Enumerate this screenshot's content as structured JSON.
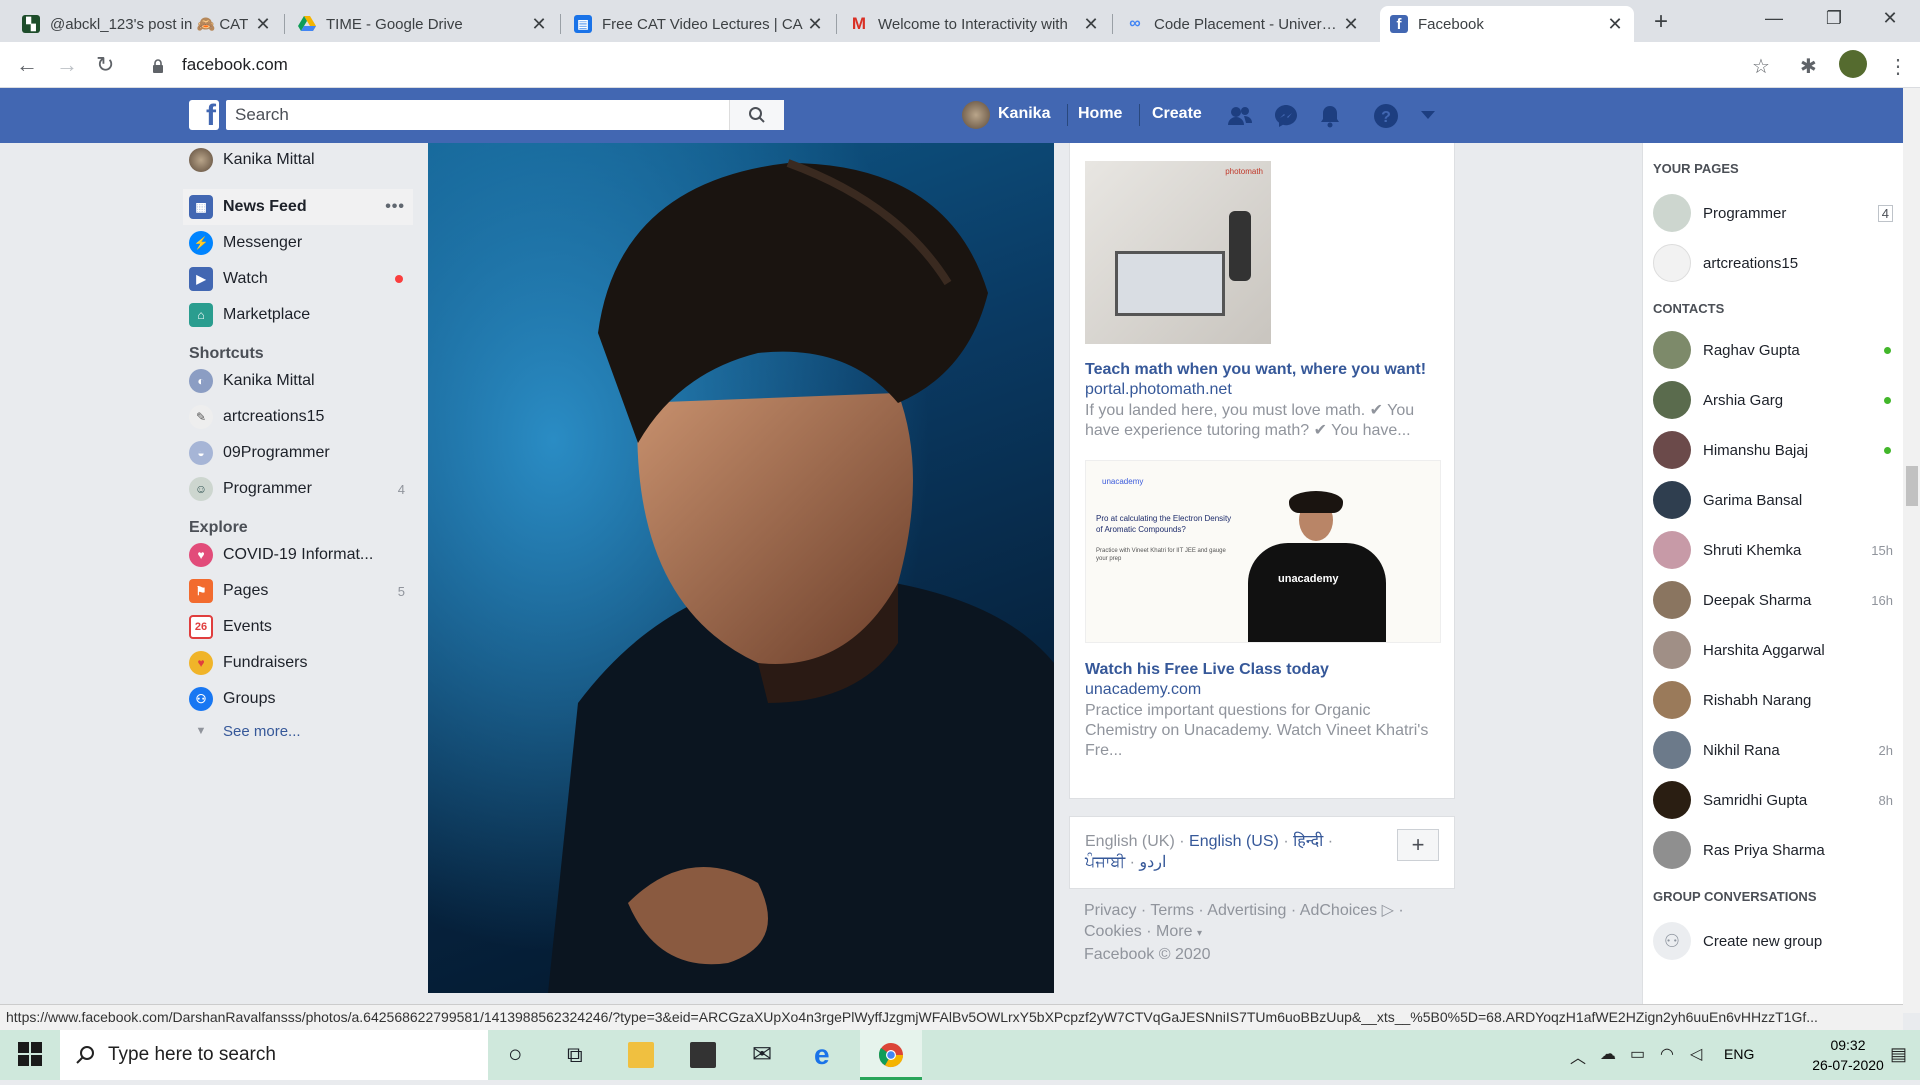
{
  "browser": {
    "tabs": [
      {
        "title": "@abckl_123's post in 🙈 CAT",
        "icon": "instagram-style-icon",
        "color": "#1e4d2b"
      },
      {
        "title": "TIME - Google Drive",
        "icon": "google-drive-icon",
        "color": "#f4b400"
      },
      {
        "title": "Free CAT Video Lectures | CA",
        "icon": "lectures-icon",
        "color": "#1a73e8"
      },
      {
        "title": "Welcome to Interactivity with",
        "icon": "gmail-icon",
        "color": "#d93025"
      },
      {
        "title": "Code Placement - University",
        "icon": "link-icon",
        "color": "#4285f4"
      },
      {
        "title": "Facebook",
        "icon": "facebook-icon",
        "color": "#4267b2"
      }
    ],
    "url": "facebook.com"
  },
  "fb": {
    "search_placeholder": "Search",
    "profile_name": "Kanika",
    "home": "Home",
    "create": "Create"
  },
  "left": {
    "user": "Kanika Mittal",
    "nav": [
      {
        "label": "News Feed",
        "icon": "news-feed-icon",
        "color": "#4267b2"
      },
      {
        "label": "Messenger",
        "icon": "messenger-icon",
        "color": "#0084ff"
      },
      {
        "label": "Watch",
        "icon": "watch-icon",
        "color": "#4267b2"
      },
      {
        "label": "Marketplace",
        "icon": "marketplace-icon",
        "color": "#2a9d8f"
      }
    ],
    "shortcuts_title": "Shortcuts",
    "shortcuts": [
      {
        "label": "Kanika Mittal",
        "count": ""
      },
      {
        "label": "artcreations15",
        "count": ""
      },
      {
        "label": "09Programmer",
        "count": ""
      },
      {
        "label": "Programmer",
        "count": "4"
      }
    ],
    "explore_title": "Explore",
    "explore": [
      {
        "label": "COVID-19 Informat...",
        "count": "",
        "icon": "covid-heart-icon",
        "color": "#e24c7a"
      },
      {
        "label": "Pages",
        "count": "5",
        "icon": "flag-icon",
        "color": "#f26b2e"
      },
      {
        "label": "Events",
        "count": "",
        "icon": "calendar-icon",
        "color": "#e03e3e"
      },
      {
        "label": "Fundraisers",
        "count": "",
        "icon": "fundraiser-heart-icon",
        "color": "#f0b429"
      },
      {
        "label": "Groups",
        "count": "",
        "icon": "groups-icon",
        "color": "#1877f2"
      }
    ],
    "see_more": "See more..."
  },
  "ads": [
    {
      "title": "Teach math when you want, where you want!",
      "link": "portal.photomath.net",
      "desc": "If you landed here, you must love math. ✔ You have experience tutoring math? ✔ You have...",
      "img_label": "photomath"
    },
    {
      "title": "Watch his Free Live Class today",
      "link": "unacademy.com",
      "desc": "Practice important questions for Organic Chemistry on Unacademy. Watch Vineet Khatri's Fre...",
      "img_label": "unacademy",
      "img_text": "Pro at calculating the Electron Density of Aromatic Compounds?",
      "img_sub": "Practice with Vineet Khatri for IIT JEE and gauge your prep",
      "shirt": "unacademy"
    }
  ],
  "languages": {
    "inactive": "English (UK)",
    "active": "English (US)",
    "others": [
      "हिन्दी",
      "ਪੰਜਾਬੀ",
      "اردو"
    ]
  },
  "footer": {
    "links": [
      "Privacy",
      "Terms",
      "Advertising",
      "AdChoices",
      "Cookies",
      "More"
    ],
    "copyright": "Facebook © 2020"
  },
  "right": {
    "your_pages": "YOUR PAGES",
    "pages": [
      {
        "name": "Programmer",
        "badge": "4"
      },
      {
        "name": "artcreations15",
        "badge": ""
      }
    ],
    "contacts_title": "CONTACTS",
    "contacts": [
      {
        "name": "Raghav Gupta",
        "meta": "",
        "online": true
      },
      {
        "name": "Arshia Garg",
        "meta": "",
        "online": true
      },
      {
        "name": "Himanshu Bajaj",
        "meta": "",
        "online": true
      },
      {
        "name": "Garima Bansal",
        "meta": "",
        "online": false
      },
      {
        "name": "Shruti Khemka",
        "meta": "15h",
        "online": false
      },
      {
        "name": "Deepak Sharma",
        "meta": "16h",
        "online": false
      },
      {
        "name": "Harshita Aggarwal",
        "meta": "",
        "online": false
      },
      {
        "name": "Rishabh Narang",
        "meta": "",
        "online": false
      },
      {
        "name": "Nikhil Rana",
        "meta": "2h",
        "online": false
      },
      {
        "name": "Samridhi Gupta",
        "meta": "8h",
        "online": false
      },
      {
        "name": "Ras Priya Sharma",
        "meta": "",
        "online": false
      }
    ],
    "group_conv": "GROUP CONVERSATIONS",
    "create_group": "Create new group"
  },
  "status_url": "https://www.facebook.com/DarshanRavalfansss/photos/a.642568622799581/1413988562324246/?type=3&eid=ARCGzaXUpXo4n3rgePlWyffJzgmjWFAlBv5OWLrxY5bXPcpzf2yW7CTVqGaJESNniIS7TUm6uoBBzUup&__xts__%5B0%5D=68.ARDYoqzH1afWE2HZign2yh6uuEn6vHHzzT1Gf...",
  "taskbar": {
    "search_placeholder": "Type here to search",
    "lang": "ENG",
    "time": "09:32",
    "date": "26-07-2020"
  }
}
